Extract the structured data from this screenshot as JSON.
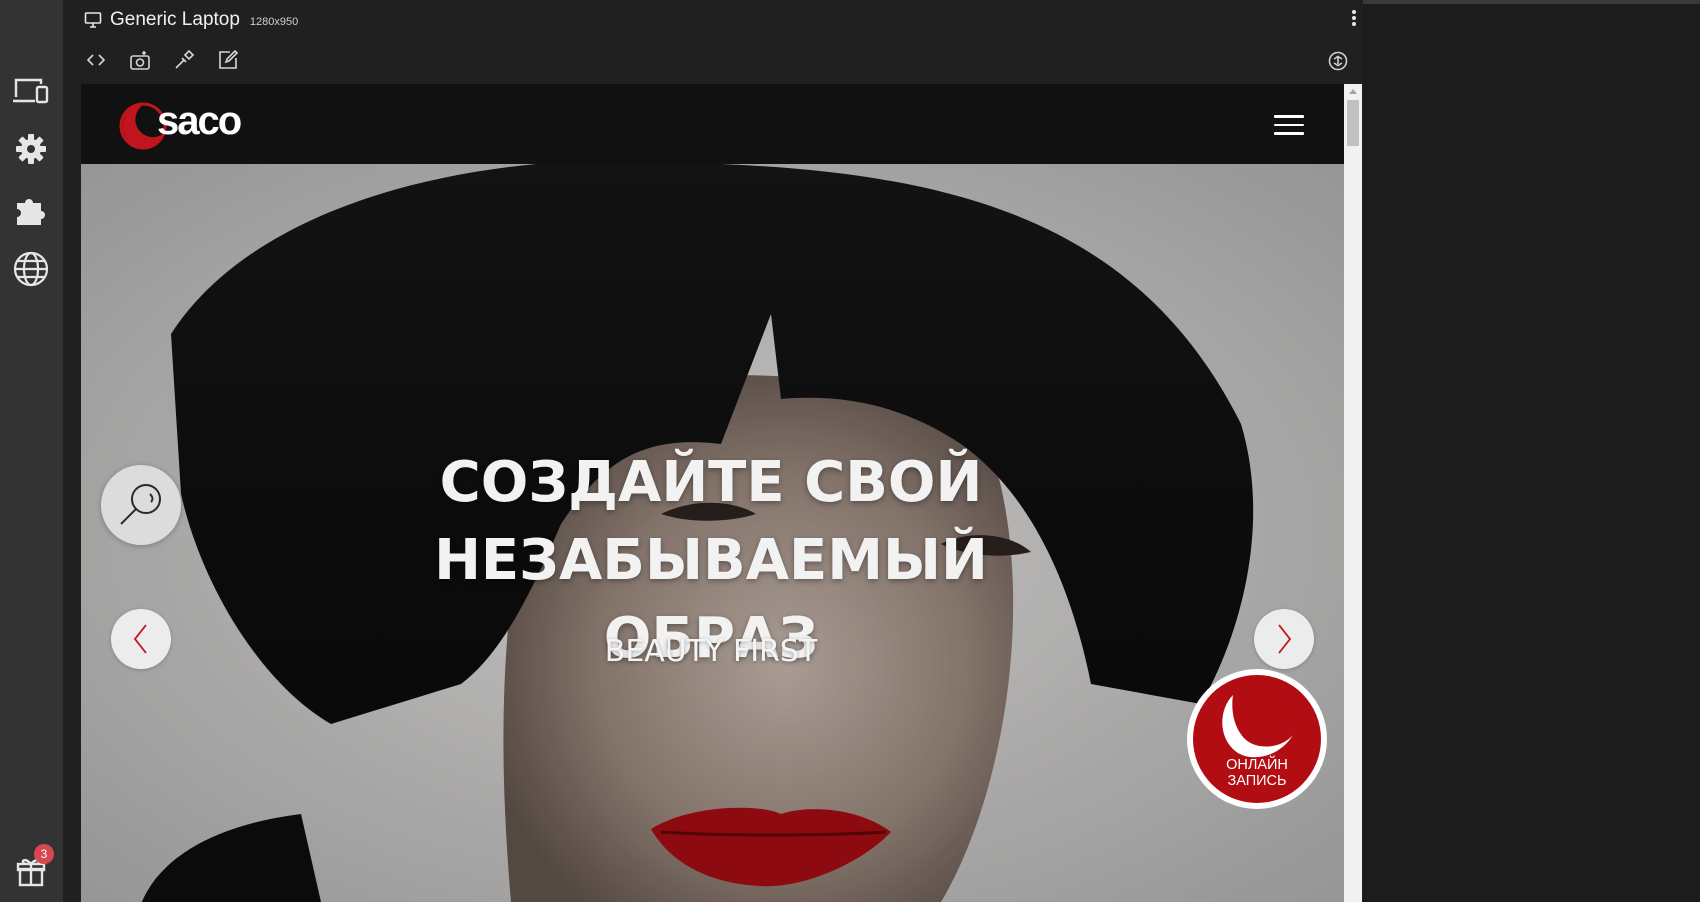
{
  "device": {
    "name": "Generic Laptop",
    "size": "1280x950"
  },
  "rail": {
    "gift_badge": "3"
  },
  "toolbar": {
    "icons": [
      "code-icon",
      "screenshot-icon",
      "inspect-icon",
      "edit-icon"
    ],
    "rotate_icon": "rotate-icon"
  },
  "site": {
    "logo_text": "saco",
    "hero_title_line1": "СОЗДАЙТЕ СВОЙ НЕЗАБЫВАЕМЫЙ",
    "hero_title_line2": "ОБРАЗ",
    "hero_subtitle": "BEAUTY FIRST",
    "online_line1": "ОНЛАЙН",
    "online_line2": "ЗАПИСЬ"
  },
  "colors": {
    "brand_red": "#b10d13",
    "rail_bg": "#333333",
    "panel_bg": "#202020",
    "badge": "#d8474f"
  }
}
